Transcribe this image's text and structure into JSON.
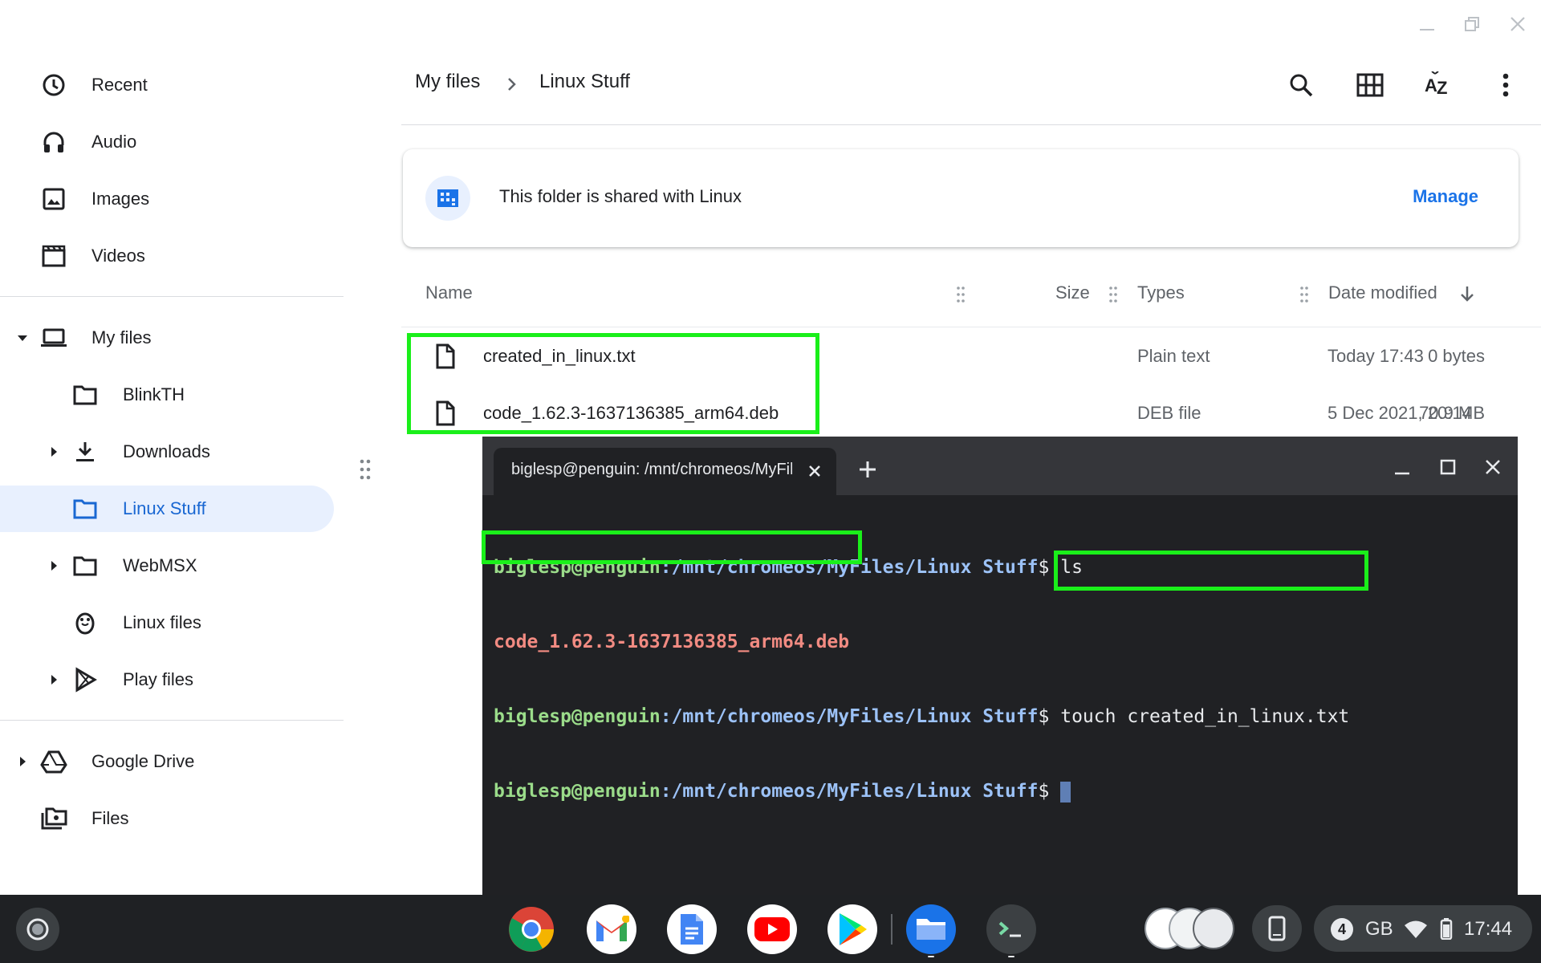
{
  "window": {
    "minimize_label": "Minimize",
    "maximize_label": "Maximize",
    "close_label": "Close"
  },
  "sidebar": {
    "quick": [
      {
        "label": "Recent",
        "icon": "clock-icon"
      },
      {
        "label": "Audio",
        "icon": "headphones-icon"
      },
      {
        "label": "Images",
        "icon": "image-icon"
      },
      {
        "label": "Videos",
        "icon": "film-icon"
      }
    ],
    "my_files": {
      "label": "My files",
      "icon": "laptop-icon",
      "expanded": true
    },
    "children": [
      {
        "label": "BlinkTH",
        "icon": "folder-icon",
        "expandable": false,
        "active": false
      },
      {
        "label": "Downloads",
        "icon": "download-icon",
        "expandable": true,
        "active": false
      },
      {
        "label": "Linux Stuff",
        "icon": "folder-icon",
        "expandable": false,
        "active": true
      },
      {
        "label": "WebMSX",
        "icon": "folder-icon",
        "expandable": true,
        "active": false
      },
      {
        "label": "Linux files",
        "icon": "penguin-icon",
        "expandable": false,
        "active": false
      },
      {
        "label": "Play files",
        "icon": "play-store-icon",
        "expandable": true,
        "active": false
      }
    ],
    "bottom": [
      {
        "label": "Google Drive",
        "icon": "drive-icon",
        "expandable": true
      },
      {
        "label": "Files",
        "icon": "files-app-icon",
        "expandable": false
      }
    ]
  },
  "breadcrumb": {
    "root": "My files",
    "current": "Linux Stuff"
  },
  "toolbar": {
    "search": "search-icon",
    "grid": "grid-view-icon",
    "sort": "sort-az-icon",
    "more": "more-vert-icon"
  },
  "banner": {
    "text": "This folder is shared with Linux",
    "button": "Manage"
  },
  "table": {
    "headers": {
      "name": "Name",
      "size": "Size",
      "type": "Types",
      "date": "Date modified"
    },
    "rows": [
      {
        "name": "created_in_linux.txt",
        "size": "0 bytes",
        "type": "Plain text",
        "date": "Today 17:43"
      },
      {
        "name": "code_1.62.3-1637136385_arm64.deb",
        "size": "70.9 MB",
        "type": "DEB file",
        "date": "5 Dec 2021, 20:14"
      }
    ]
  },
  "terminal": {
    "tab_title": "biglesp@penguin: /mnt/chromeos/MyFiles/Linux Stuff",
    "user": "biglesp@penguin",
    "path": ":/mnt/chromeos/MyFiles/Linux Stuff",
    "prompt_suffix": "$ ",
    "cmd1": "ls",
    "output1": "code_1.62.3-1637136385_arm64.deb",
    "cmd2": "touch created_in_linux.txt"
  },
  "shelf": {
    "apps": [
      "chrome-icon",
      "gmail-icon",
      "docs-icon",
      "youtube-icon",
      "play-store-icon",
      "files-icon",
      "terminal-icon"
    ],
    "notification_count": "4",
    "locale": "GB",
    "time": "17:44"
  },
  "colors": {
    "accent": "#1a73e8",
    "highlight": "#1aef1a",
    "active_bg": "#e8f0fe",
    "terminal_bg": "#202124"
  }
}
